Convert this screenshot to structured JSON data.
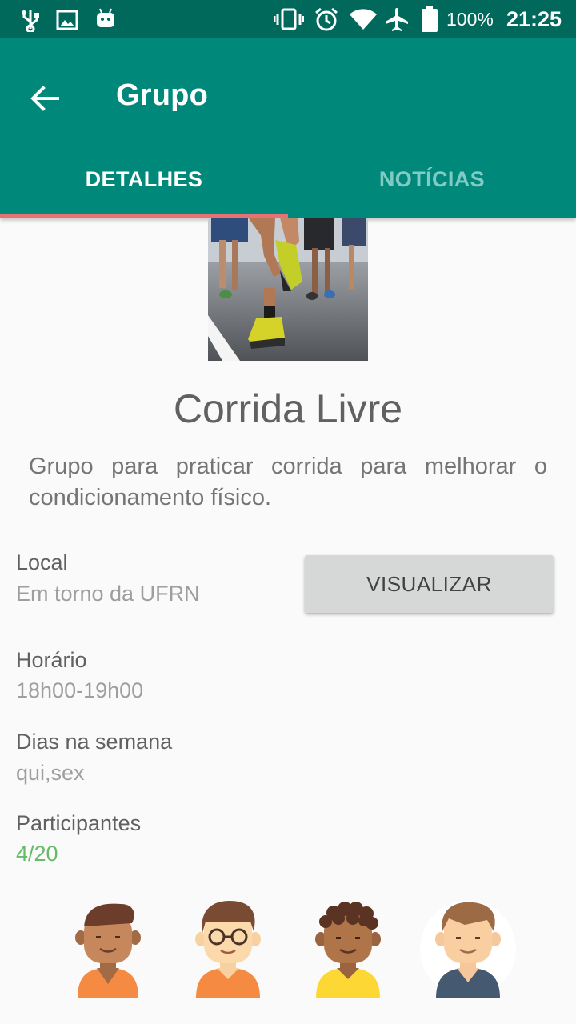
{
  "status_bar": {
    "battery_percent": "100%",
    "time": "21:25",
    "icons": [
      "usb-icon",
      "image-icon",
      "android-icon",
      "vibrate-icon",
      "alarm-icon",
      "wifi-icon",
      "airplane-icon",
      "battery-icon"
    ]
  },
  "app_bar": {
    "title": "Grupo",
    "back_icon": "arrow-back-icon"
  },
  "tabs": [
    {
      "label": "DETALHES",
      "selected": true
    },
    {
      "label": "NOTÍCIAS",
      "selected": false
    }
  ],
  "colors": {
    "primary": "#00897b",
    "primary_dark": "#00695c",
    "tab_indicator": "#e57373",
    "participants_count": "#66bb6a"
  },
  "group": {
    "name": "Corrida Livre",
    "description": "Grupo para praticar corrida para melhorar o condicionamento físico.",
    "image": "running-shoes-photo"
  },
  "details": {
    "local_label": "Local",
    "local_value": "Em torno da UFRN",
    "view_button": "VISUALIZAR",
    "horario_label": "Horário",
    "horario_value": "18h00-19h00",
    "dias_label": "Dias na semana",
    "dias_value": "qui,sex",
    "participantes_label": "Participantes",
    "participantes_value": "4/20"
  },
  "participants": [
    {
      "avatar": "avatar-boy-tan-icon"
    },
    {
      "avatar": "avatar-boy-glasses-icon"
    },
    {
      "avatar": "avatar-boy-curly-icon"
    },
    {
      "avatar": "avatar-boy-blue-shirt-icon"
    }
  ]
}
